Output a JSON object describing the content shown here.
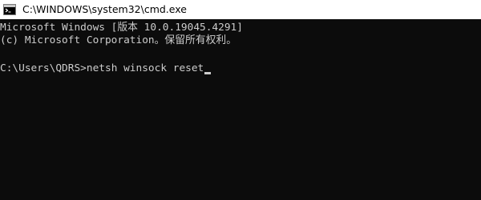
{
  "window": {
    "title": "C:\\WINDOWS\\system32\\cmd.exe",
    "icon": "cmd-icon"
  },
  "console": {
    "lines": [
      "Microsoft Windows [版本 10.0.19045.4291]",
      "(c) Microsoft Corporation。保留所有权利。"
    ],
    "prompt": "C:\\Users\\QDRS>",
    "command": "netsh winsock reset"
  },
  "colors": {
    "background": "#0c0c0c",
    "text": "#cccccc",
    "titlebar": "#ffffff"
  }
}
